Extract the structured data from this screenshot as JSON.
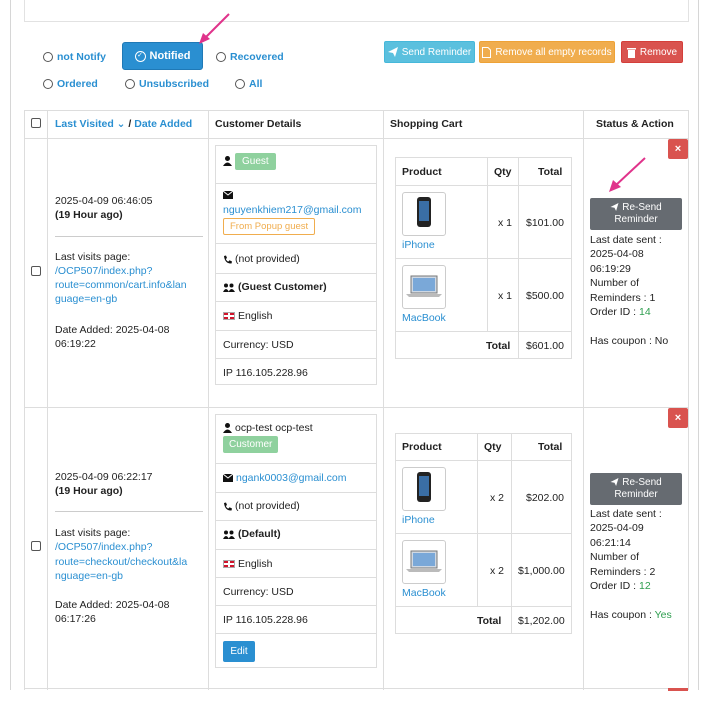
{
  "filters": {
    "not_notify": "not Notify",
    "notified": "Notified",
    "recovered": "Recovered",
    "ordered": "Ordered",
    "unsubscribed": "Unsubscribed",
    "all": "All"
  },
  "actions": {
    "send_reminder": "Send Reminder",
    "remove_empty": "Remove all empty records",
    "remove": "Remove"
  },
  "columns": {
    "last_visited": "Last Visited",
    "sep": "/",
    "date_added": "Date Added",
    "customer_details": "Customer Details",
    "shopping_cart": "Shopping Cart",
    "status_action": "Status & Action"
  },
  "cart_headers": {
    "product": "Product",
    "qty": "Qty",
    "total": "Total",
    "total_label": "Total"
  },
  "rows": [
    {
      "datetime": "2025-04-09 06:46:05",
      "ago": "(19 Hour ago)",
      "last_visit_label": "Last visits page:",
      "last_visit_url_1": "/OCP507/index.php?",
      "last_visit_url_2": "route=common/cart.info&lan",
      "last_visit_url_3": "guage=en-gb",
      "date_added_1": "Date Added: 2025-04-08",
      "date_added_2": "06:19:22",
      "name": "",
      "badge": "Guest",
      "email": "nguyenkhiem217@gmail.com",
      "popup": "From Popup guest",
      "phone": "(not provided)",
      "group": "(Guest Customer)",
      "language": "English",
      "currency": "Currency: USD",
      "ip": "IP 116.105.228.96",
      "products": [
        {
          "name": "iPhone",
          "qty": "x 1",
          "total": "$101.00"
        },
        {
          "name": "MacBook",
          "qty": "x 1",
          "total": "$500.00"
        }
      ],
      "cart_total": "$601.00",
      "resend_1": "Re-Send",
      "resend_2": "Reminder",
      "last_sent_1": "Last date sent :",
      "last_sent_2": "2025-04-08",
      "last_sent_3": "06:19:29",
      "num_rem_1": "Number of",
      "num_rem_2": "Reminders : 1",
      "order_id_label": "Order ID :",
      "order_id": "14",
      "coupon_label": "Has coupon :",
      "coupon": "No"
    },
    {
      "datetime": "2025-04-09 06:22:17",
      "ago": "(19 Hour ago)",
      "last_visit_label": "Last visits page:",
      "last_visit_url_1": "/OCP507/index.php?",
      "last_visit_url_2": "route=checkout/checkout&la",
      "last_visit_url_3": "nguage=en-gb",
      "date_added_1": "Date Added: 2025-04-08",
      "date_added_2": "06:17:26",
      "name": "ocp-test ocp-test",
      "badge": "Customer",
      "email": "ngank0003@gmail.com",
      "phone": "(not provided)",
      "group": "(Default)",
      "language": "English",
      "currency": "Currency: USD",
      "ip": "IP 116.105.228.96",
      "edit": "Edit",
      "products": [
        {
          "name": "iPhone",
          "qty": "x 2",
          "total": "$202.00"
        },
        {
          "name": "MacBook",
          "qty": "x 2",
          "total": "$1,000.00"
        }
      ],
      "cart_total": "$1,202.00",
      "resend_1": "Re-Send",
      "resend_2": "Reminder",
      "last_sent_1": "Last date sent :",
      "last_sent_2": "2025-04-09",
      "last_sent_3": "06:21:14",
      "num_rem_1": "Number of",
      "num_rem_2": "Reminders : 2",
      "order_id_label": "Order ID :",
      "order_id": "12",
      "coupon_label": "Has coupon :",
      "coupon": "Yes"
    }
  ],
  "icons": {
    "user": "user-icon",
    "envelope": "envelope-icon",
    "phone": "phone-icon",
    "users": "users-icon",
    "flag": "uk-flag-icon",
    "paper_plane": "paper-plane-icon",
    "file": "file-icon",
    "trash": "trash-icon",
    "close": "close-icon",
    "arrow": "pink-arrow-annotation"
  },
  "colors": {
    "primary": "#2a8fd1",
    "info": "#5bc0de",
    "warning": "#f0ad4e",
    "danger": "#d9534f",
    "success_badge": "#8fd19e",
    "gray_button": "#666b71",
    "annotation": "#e0338b"
  }
}
